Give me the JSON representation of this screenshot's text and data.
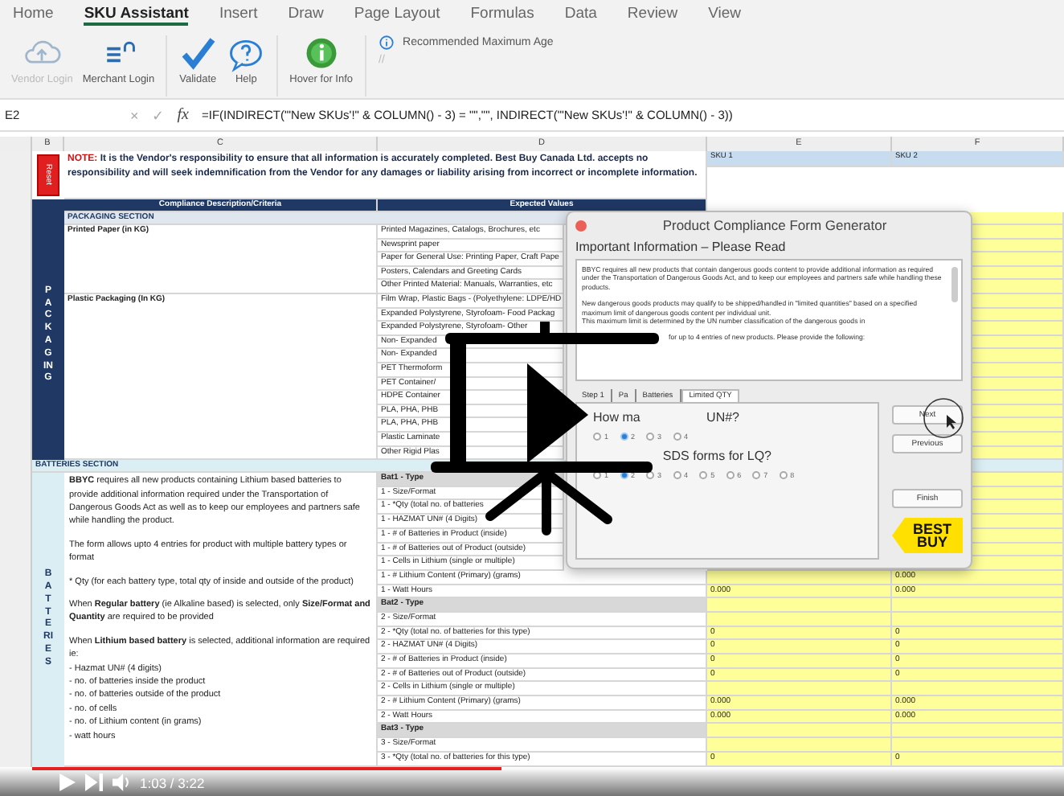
{
  "ribbon": {
    "tabs": [
      {
        "label": "Home",
        "selected": false
      },
      {
        "label": "SKU Assistant",
        "selected": true
      },
      {
        "label": "Insert",
        "selected": false
      },
      {
        "label": "Draw",
        "selected": false
      },
      {
        "label": "Page Layout",
        "selected": false
      },
      {
        "label": "Formulas",
        "selected": false
      },
      {
        "label": "Data",
        "selected": false
      },
      {
        "label": "Review",
        "selected": false
      },
      {
        "label": "View",
        "selected": false
      }
    ],
    "buttons": [
      {
        "label": "Vendor Login",
        "kind": "cloud",
        "disabled": true
      },
      {
        "label": "Merchant Login",
        "kind": "login",
        "disabled": false
      },
      {
        "label": "Validate",
        "kind": "check",
        "disabled": false
      },
      {
        "label": "Help",
        "kind": "help",
        "disabled": false
      },
      {
        "label": "Hover for Info",
        "kind": "info",
        "disabled": false
      }
    ],
    "info_label": "Recommended Maximum Age",
    "info_mark": "//"
  },
  "formula_bar": {
    "cell": "E2",
    "cancel": "×",
    "enter": "✓",
    "fx": "fx",
    "formula": "=IF(INDIRECT(\"'New SKUs'!\" & COLUMN() - 3) = \"\",\"\", INDIRECT(\"'New SKUs'!\" & COLUMN() - 3))"
  },
  "sheet": {
    "columns": [
      "B",
      "C",
      "D",
      "E",
      "F"
    ],
    "reset_button": "Reset",
    "note": "**NOTE:** It is the Vendor's responsibility to ensure that all information is accurately completed. Best Buy Canada Ltd. accepts no responsibility and will seek indemnification from the Vendor for any damages or liability arising from incorrect or incomplete information.",
    "sku_headers": [
      "SKU 1",
      "SKU 2"
    ],
    "table_header": [
      "Compliance Description/Criteria",
      "Expected Values"
    ],
    "packaging": {
      "section": "PACKAGING SECTION",
      "side_label": "PACKAGING",
      "groups": [
        {
          "label": "Printed Paper (in KG)",
          "items": [
            "Printed Magazines, Catalogs, Brochures, etc",
            "Newsprint paper",
            "Paper for General Use: Printing Paper, Craft Pape",
            "Posters, Calendars and Greeting Cards",
            "Other Printed Material: Manuals, Warranties, etc"
          ]
        },
        {
          "label": "Plastic Packaging (In KG)",
          "items": [
            "Film Wrap, Plastic Bags - (Polyethylene: LDPE/HD",
            "Expanded Polystyrene, Styrofoam- Food Packag",
            "Expanded Polystyrene, Styrofoam- Other",
            "Non- Expanded",
            "Non- Expanded",
            "PET Thermoform",
            "PET Container/",
            "HDPE Container",
            "PLA, PHA, PHB",
            "PLA, PHA, PHB",
            "Plastic Laminate",
            "Other Rigid Plas"
          ]
        }
      ]
    },
    "batteries": {
      "section": "BATTERIES SECTION",
      "side_label": "BATTERIES",
      "paragraphs": [
        "**BBYC** requires all new products containing Lithium based batteries to provide additional information required under the Transportation of Dangerous Goods Act as well as to keep our employees and partners safe while handling the product.",
        "The form allows upto 4 entries for product with multiple battery types or format",
        "* Qty (for each battery type,  total qty of inside and outside of the product)",
        "When **Regular battery** (ie Alkaline based) is selected, only **Size/Format and Quantity** are required to be provided",
        "When **Lithium  based battery** is selected, additional information are required ie:\n- Hazmat UN# (4 digits)\n- no. of batteries inside the product\n- no. of batteries outside of the product\n- no. of cells\n- no. of Lithium content (in grams)\n- watt hours"
      ],
      "rows": [
        {
          "label": "Bat1 - Type",
          "kind": "group"
        },
        {
          "label": "1 - Size/Format",
          "kind": "item"
        },
        {
          "label": "1 - *Qty (total no. of batteries",
          "kind": "item"
        },
        {
          "label": "1 - HAZMAT UN# (4 Digits)",
          "kind": "item"
        },
        {
          "label": "1 - # of Batteries in Product (inside)",
          "kind": "item"
        },
        {
          "label": "1 - # of Batteries out of Product (outside)",
          "kind": "item"
        },
        {
          "label": "1 - Cells in Lithium (single or multiple)",
          "kind": "item"
        },
        {
          "label": "1 - # Lithium Content (Primary) (grams)",
          "kind": "item",
          "sku_2": "0.000"
        },
        {
          "label": "1 - Watt Hours",
          "kind": "item",
          "sku_1": "0.000",
          "sku_2": "0.000"
        },
        {
          "label": "Bat2 - Type",
          "kind": "group"
        },
        {
          "label": "2 - Size/Format",
          "kind": "item"
        },
        {
          "label": "2 - *Qty (total no. of batteries for this type)",
          "kind": "item",
          "sku_1": "0",
          "sku_2": "0"
        },
        {
          "label": "2 - HAZMAT UN# (4 Digits)",
          "kind": "item",
          "sku_1": "0",
          "sku_2": "0"
        },
        {
          "label": "2 - # of Batteries in Product (inside)",
          "kind": "item",
          "sku_1": "0",
          "sku_2": "0"
        },
        {
          "label": "2 - # of Batteries out of Product (outside)",
          "kind": "item",
          "sku_1": "0",
          "sku_2": "0"
        },
        {
          "label": "2 - Cells in Lithium (single or multiple)",
          "kind": "item"
        },
        {
          "label": "2 - # Lithium Content (Primary) (grams)",
          "kind": "item",
          "sku_1": "0.000",
          "sku_2": "0.000"
        },
        {
          "label": "2 - Watt Hours",
          "kind": "item",
          "sku_1": "0.000",
          "sku_2": "0.000"
        },
        {
          "label": "Bat3 - Type",
          "kind": "group"
        },
        {
          "label": "3 - Size/Format",
          "kind": "item"
        },
        {
          "label": "3 - *Qty (total no. of batteries for this type)",
          "kind": "item",
          "sku_1": "0",
          "sku_2": "0"
        }
      ]
    }
  },
  "dialog": {
    "title": "Product Compliance Form Generator",
    "heading": "Important Information – Please Read",
    "info_paragraphs": [
      "BBYC requires all new products that contain dangerous goods content to provide additional information as required under the Transportation of Dangerous Goods Act, and to keep our employees and partners safe while handling these products.",
      "New dangerous goods products may qualify to be shipped/handled in \"limited quantities\" based on a specified maximum limit of dangerous goods content per individual unit.\nThis maximum limit is determined by the UN number classification of the dangerous goods in",
      "for up to 4 entries of new products. Please provide the following:"
    ],
    "tabs": [
      {
        "label": "Step 1",
        "selected": false
      },
      {
        "label": "Pa",
        "selected": false
      },
      {
        "label": "Batteries",
        "selected": false
      },
      {
        "label": "Limited QTY",
        "selected": true
      }
    ],
    "questions": [
      {
        "label": "How ma",
        "label_end": "UN#?",
        "options": [
          {
            "label": "1",
            "selected": false
          },
          {
            "label": "2",
            "selected": true
          },
          {
            "label": "3",
            "selected": false
          },
          {
            "label": "4",
            "selected": false
          }
        ]
      },
      {
        "label_end": "SDS forms for LQ?",
        "options": [
          {
            "label": "1",
            "selected": false
          },
          {
            "label": "2",
            "selected": true
          },
          {
            "label": "3",
            "selected": false
          },
          {
            "label": "4",
            "selected": false
          },
          {
            "label": "5",
            "selected": false
          },
          {
            "label": "6",
            "selected": false
          },
          {
            "label": "7",
            "selected": false
          },
          {
            "label": "8",
            "selected": false
          }
        ]
      }
    ],
    "buttons": [
      "Next",
      "Previous",
      "Finish"
    ],
    "logo": "BEST BUY"
  },
  "player": {
    "level": 0.46,
    "time": "1:03 / 3:22"
  }
}
